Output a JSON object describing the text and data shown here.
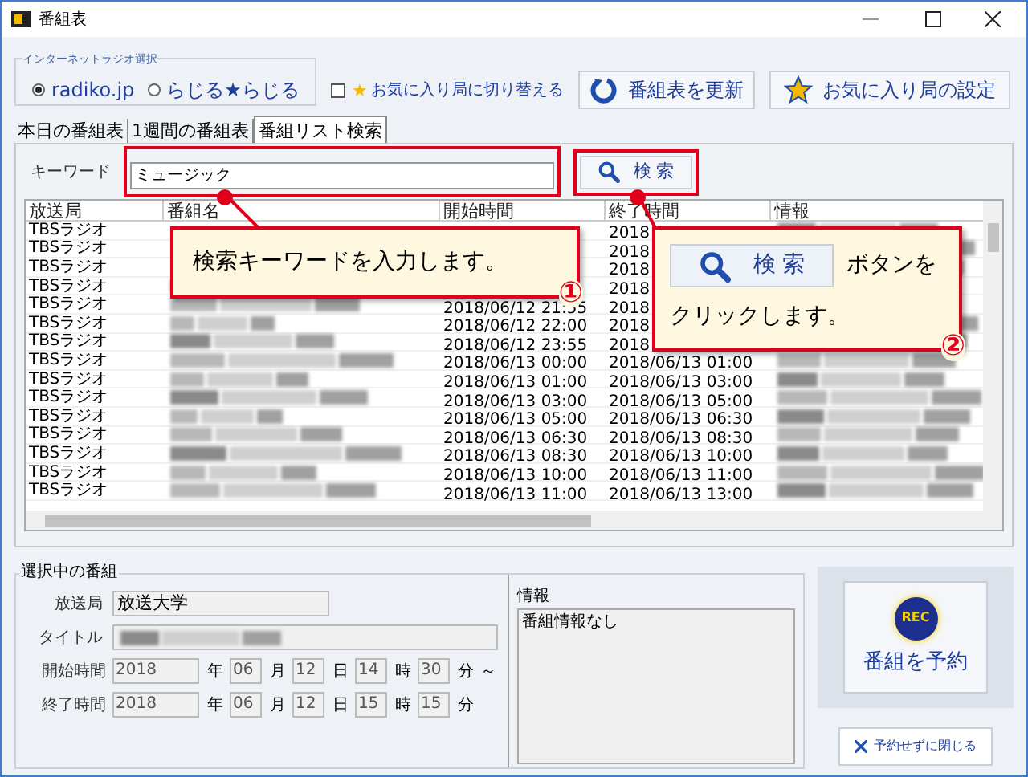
{
  "window": {
    "title": "番組表"
  },
  "radio_group": {
    "label": "インターネットラジオ選択",
    "options": [
      {
        "label": "radiko.jp",
        "selected": true
      },
      {
        "label": "らじる★らじる",
        "selected": false
      }
    ]
  },
  "favorite_toggle": {
    "star": "★",
    "label": "お気に入り局に切り替える",
    "checked": false
  },
  "toolbar_buttons": [
    {
      "kind": "refresh",
      "label": "番組表を更新"
    },
    {
      "kind": "favorite",
      "label": "お気に入り局の設定"
    }
  ],
  "tabs": [
    {
      "label": "本日の番組表",
      "selected": false
    },
    {
      "label": "1週間の番組表",
      "selected": false
    },
    {
      "label": "番組リスト検索",
      "selected": true
    }
  ],
  "keyword": {
    "label": "キーワード",
    "value": "ミュージック"
  },
  "search_button": {
    "label": "検 索"
  },
  "table": {
    "columns": [
      "放送局",
      "番組名",
      "開始時間",
      "終了時間",
      "情報"
    ],
    "rows": [
      {
        "station": "TBSラジオ",
        "end": "2018"
      },
      {
        "station": "TBSラジオ",
        "end": "2018"
      },
      {
        "station": "TBSラジオ",
        "end": "2018"
      },
      {
        "station": "TBSラジオ",
        "end": "2018"
      },
      {
        "station": "TBSラジオ",
        "start": "2018/06/12 21:55",
        "end": "2018"
      },
      {
        "station": "TBSラジオ",
        "start": "2018/06/12 22:00",
        "end": "2018"
      },
      {
        "station": "TBSラジオ",
        "start": "2018/06/12 23:55",
        "end": "2018"
      },
      {
        "station": "TBSラジオ",
        "start": "2018/06/13 00:00",
        "end": "2018/06/13 01:00"
      },
      {
        "station": "TBSラジオ",
        "start": "2018/06/13 01:00",
        "end": "2018/06/13 03:00"
      },
      {
        "station": "TBSラジオ",
        "start": "2018/06/13 03:00",
        "end": "2018/06/13 05:00"
      },
      {
        "station": "TBSラジオ",
        "start": "2018/06/13 05:00",
        "end": "2018/06/13 06:30"
      },
      {
        "station": "TBSラジオ",
        "start": "2018/06/13 06:30",
        "end": "2018/06/13 08:30"
      },
      {
        "station": "TBSラジオ",
        "start": "2018/06/13 08:30",
        "end": "2018/06/13 10:00"
      },
      {
        "station": "TBSラジオ",
        "start": "2018/06/13 10:00",
        "end": "2018/06/13 11:00"
      },
      {
        "station": "TBSラジオ",
        "start": "2018/06/13 11:00",
        "end": "2018/06/13 13:00"
      }
    ]
  },
  "callouts": [
    {
      "number": "①",
      "text": "検索キーワードを入力します。"
    },
    {
      "number": "②",
      "button_label": "検 索",
      "text": "ボタンを",
      "text_2": "クリックします。"
    }
  ],
  "selected_program": {
    "title": "選択中の番組",
    "station_label": "放送局",
    "station": "放送大学",
    "title_label": "タイトル",
    "times": [
      {
        "label": "開始時間",
        "fields": [
          {
            "value": "2018",
            "unit": "年"
          },
          {
            "value": "06",
            "unit": "月"
          },
          {
            "value": "12",
            "unit": "日"
          },
          {
            "value": "14",
            "unit": "時"
          },
          {
            "value": "30",
            "unit": "分"
          }
        ],
        "suffix": "～"
      },
      {
        "label": "終了時間",
        "fields": [
          {
            "value": "2018",
            "unit": "年"
          },
          {
            "value": "06",
            "unit": "月"
          },
          {
            "value": "12",
            "unit": "日"
          },
          {
            "value": "15",
            "unit": "時"
          },
          {
            "value": "15",
            "unit": "分"
          }
        ]
      }
    ]
  },
  "info": {
    "label": "情報",
    "value": "番組情報なし"
  },
  "reserve_button": {
    "badge": "REC",
    "label": "番組を予約"
  },
  "close_button": {
    "label": "予約せずに閉じる"
  }
}
